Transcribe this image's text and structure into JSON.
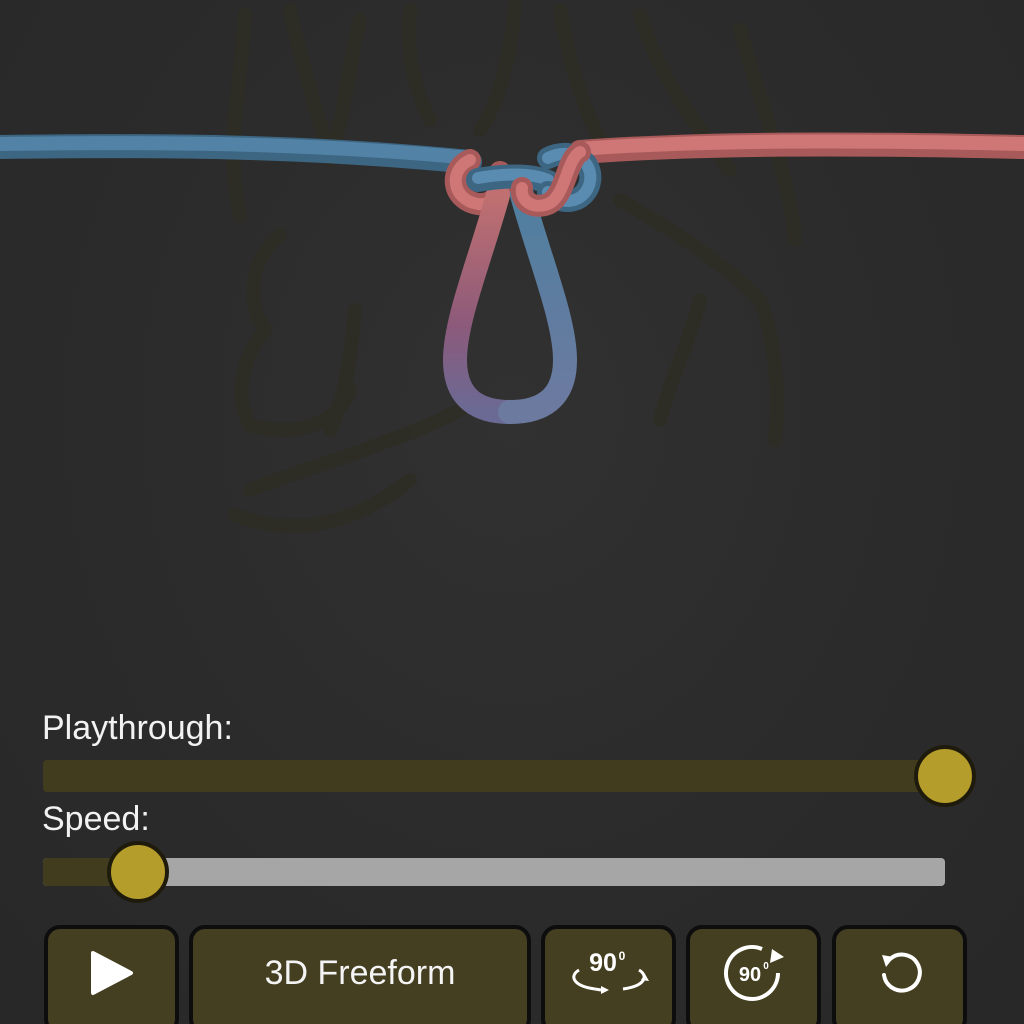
{
  "controls": {
    "playthrough_label": "Playthrough:",
    "playthrough_value": 1.0,
    "speed_label": "Speed:",
    "speed_value": 0.105
  },
  "toolbar": {
    "mode_label": "3D Freeform",
    "rotate_horizontal_text": "90",
    "rotate_horizontal_sup": "0",
    "rotate_vertical_text": "90",
    "rotate_vertical_sup": "0"
  },
  "icons": {
    "play": "play-icon",
    "rotate_horizontal": "rotate-horizontal-90-icon",
    "rotate_vertical": "rotate-vertical-90-icon",
    "reset": "reset-icon"
  },
  "colors": {
    "rope_blue": "#4f7f9f",
    "rope_red": "#c56c6c",
    "accent": "#b59d2b",
    "button_bg": "#453f21",
    "track_fill": "#423c1e",
    "track_empty": "#a6a6a6"
  }
}
